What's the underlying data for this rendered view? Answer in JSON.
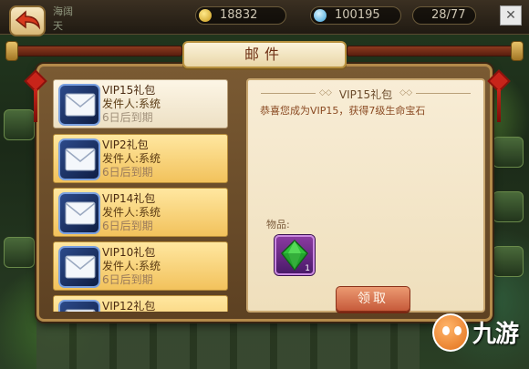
{
  "top_bar": {
    "gold": "18832",
    "gems": "100195",
    "stamina": "28/77",
    "bg_text_1": "海阔",
    "bg_text_2": "天"
  },
  "dialog": {
    "title": "邮件"
  },
  "mails": [
    {
      "title": "VIP15礼包",
      "sender": "发件人:系统",
      "expiry": "6日后到期",
      "read": true
    },
    {
      "title": "VIP2礼包",
      "sender": "发件人:系统",
      "expiry": "6日后到期",
      "read": false
    },
    {
      "title": "VIP14礼包",
      "sender": "发件人:系统",
      "expiry": "6日后到期",
      "read": false
    },
    {
      "title": "VIP10礼包",
      "sender": "发件人:系统",
      "expiry": "6日后到期",
      "read": false
    },
    {
      "title": "VIP12礼包",
      "sender": "",
      "expiry": "",
      "read": false
    }
  ],
  "detail": {
    "title": "VIP15礼包",
    "body": "恭喜您成为VIP15，获得7级生命宝石",
    "items_label": "物品:",
    "item_count": "1",
    "item_icon": "green-gem-icon",
    "claim_label": "领取"
  },
  "watermark": {
    "text": "九游"
  },
  "colors": {
    "unread_item": "#f2c25c",
    "read_item": "#ede0c4",
    "title_text": "#6e2f14",
    "claim_button": "#c65a3a",
    "item_slot": "#8a3aa0"
  }
}
